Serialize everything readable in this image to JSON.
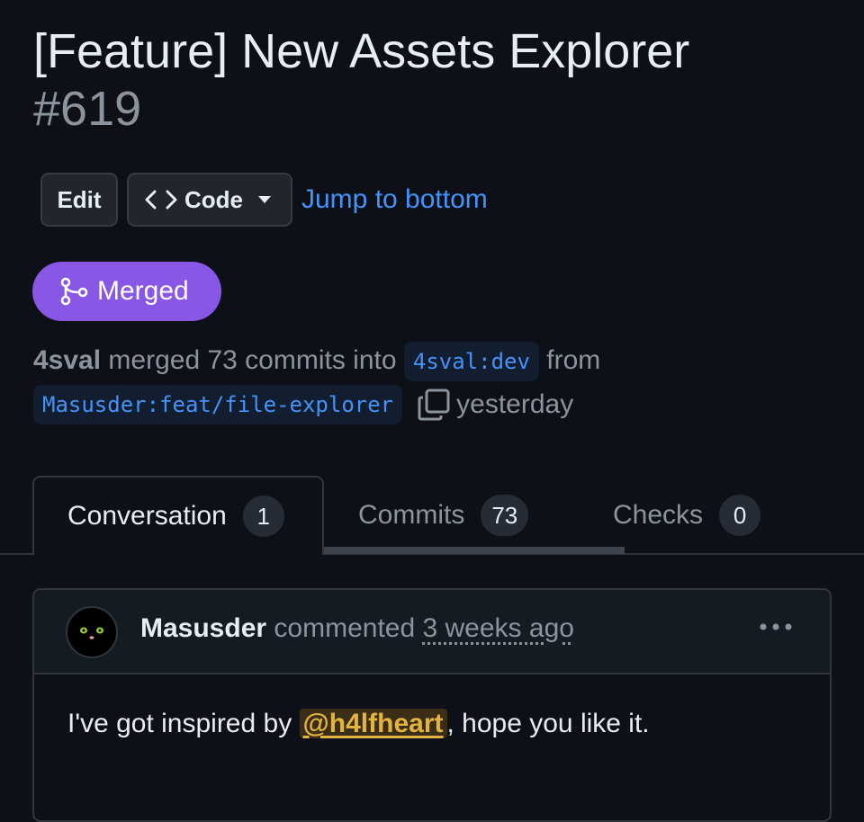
{
  "pr": {
    "title": "[Feature] New Assets Explorer",
    "number": "#619"
  },
  "toolbar": {
    "edit_label": "Edit",
    "code_label": "Code",
    "code_icon": "code-brackets-icon",
    "caret_icon": "triangle-down-icon",
    "jump_label": "Jump to bottom"
  },
  "state": {
    "label": "Merged",
    "icon": "git-merge-icon",
    "color": "#8957e5"
  },
  "merge_info": {
    "user": "4sval",
    "text_merged": "merged 73 commits into",
    "base_branch": "4sval:dev",
    "text_from": "from",
    "head_branch": "Masusder:feat/file-explorer",
    "copy_icon": "copy-icon",
    "time": "yesterday"
  },
  "tabs": [
    {
      "label": "Conversation",
      "count": "1",
      "active": true
    },
    {
      "label": "Commits",
      "count": "73",
      "active": false
    },
    {
      "label": "Checks",
      "count": "0",
      "active": false
    }
  ],
  "comment": {
    "author": "Masusder",
    "action": "commented",
    "time": "3 weeks ago",
    "menu_icon": "kebab-horizontal-icon",
    "body_prefix": "I've got inspired by",
    "mention": "@h4lfheart",
    "body_suffix": ", hope you like it."
  },
  "colors": {
    "background": "#0d1117",
    "link": "#4493f8",
    "merged": "#8957e5",
    "mention": "#e3b341"
  }
}
